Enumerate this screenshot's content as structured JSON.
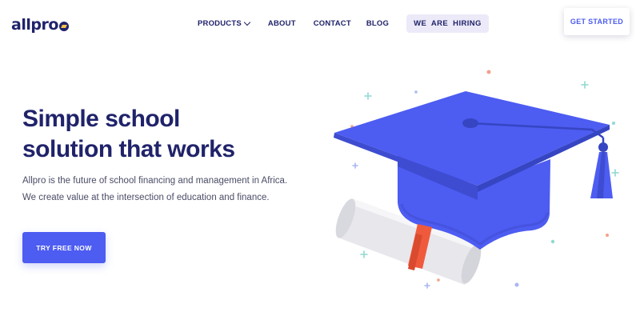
{
  "brand": {
    "logo_text": "allpro"
  },
  "nav": {
    "products_label": "PRODUCTS",
    "about_label": "ABOUT",
    "contact_label": "CONTACT",
    "blog_label": "BLOG",
    "hiring_label": "WE ARE HIRING"
  },
  "header": {
    "cta_label": "GET STARTED"
  },
  "hero": {
    "title_line1": "Simple school",
    "title_line2": "solution that works",
    "description_line1": "Allpro is the future of school financing and management in Africa.",
    "description_line2": "We create value at the intersection of education and finance.",
    "cta_label": "TRY FREE NOW"
  },
  "colors": {
    "brand_navy": "#20236a",
    "accent_blue": "#4d5cf1",
    "tassel_red": "#f05a3c"
  },
  "icons": [
    "chevron-down-icon",
    "graduation-cap-icon",
    "diploma-scroll-icon",
    "sparkle-icon"
  ]
}
